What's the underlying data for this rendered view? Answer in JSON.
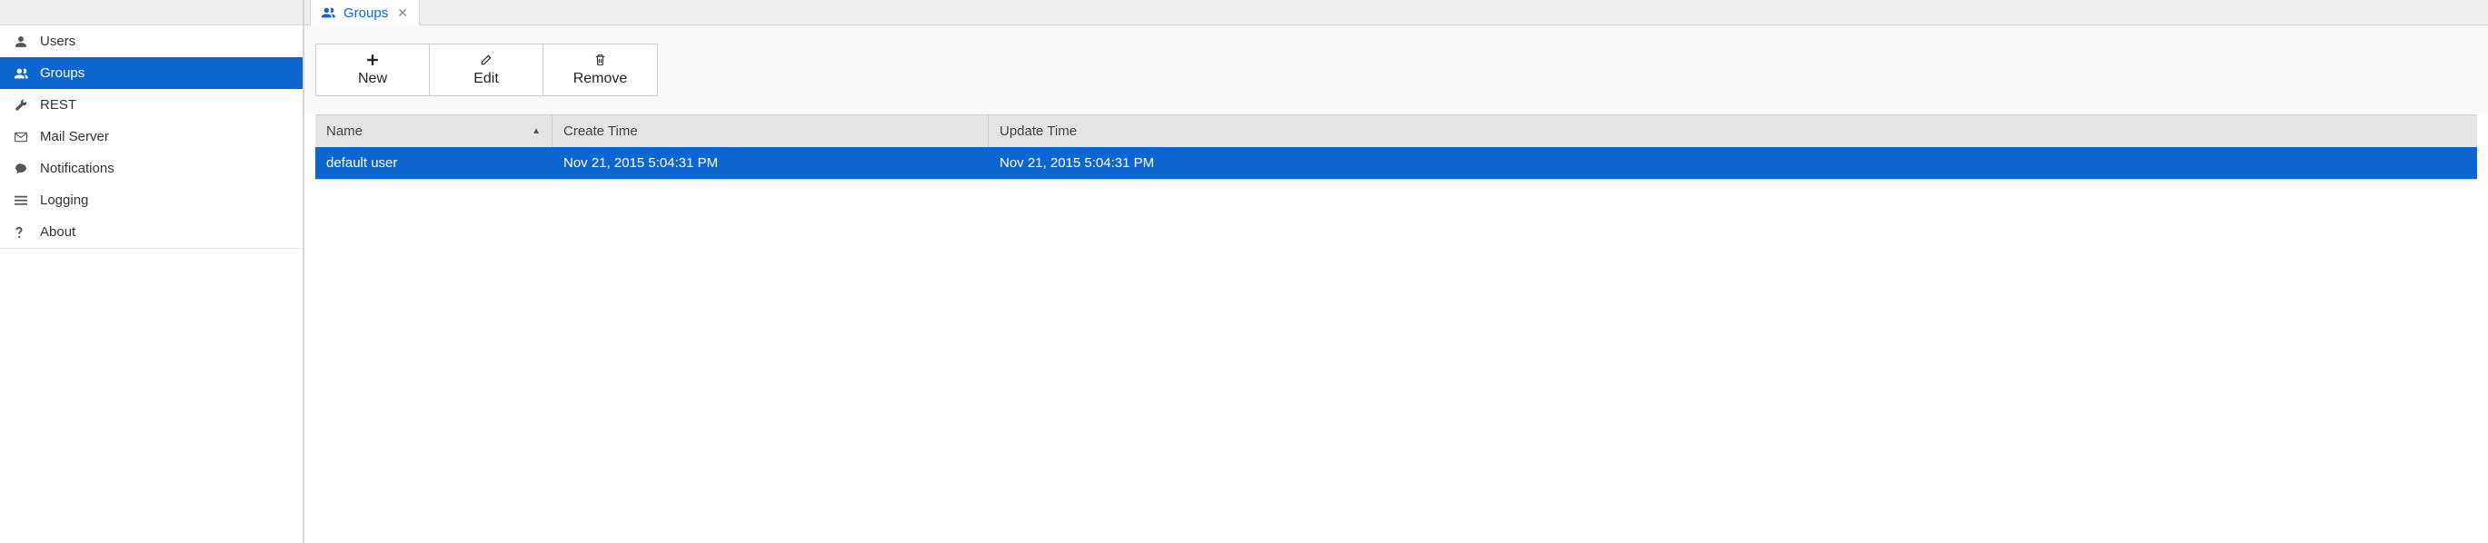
{
  "sidebar": {
    "items": [
      {
        "label": "Users",
        "icon": "user",
        "active": false
      },
      {
        "label": "Groups",
        "icon": "users",
        "active": true
      },
      {
        "label": "REST",
        "icon": "wrench",
        "active": false
      },
      {
        "label": "Mail Server",
        "icon": "mail",
        "active": false
      },
      {
        "label": "Notifications",
        "icon": "chat",
        "active": false
      },
      {
        "label": "Logging",
        "icon": "bars",
        "active": false
      },
      {
        "label": "About",
        "icon": "question",
        "active": false
      }
    ]
  },
  "tab": {
    "label": "Groups"
  },
  "toolbar": {
    "new_label": "New",
    "edit_label": "Edit",
    "remove_label": "Remove"
  },
  "table": {
    "columns": {
      "name": "Name",
      "create": "Create Time",
      "update": "Update Time"
    },
    "rows": [
      {
        "name": "default user",
        "create": "Nov 21, 2015 5:04:31 PM",
        "update": "Nov 21, 2015 5:04:31 PM",
        "selected": true
      }
    ]
  }
}
